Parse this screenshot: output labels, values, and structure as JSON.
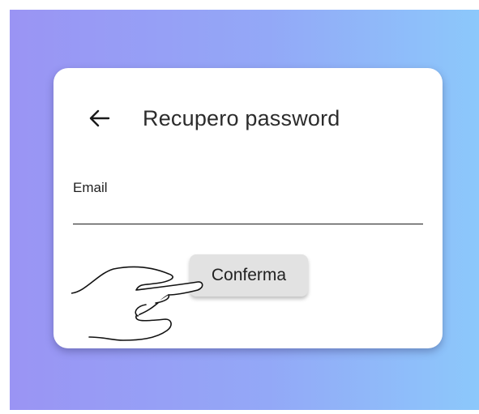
{
  "header": {
    "back_icon": "arrow-left-icon",
    "title": "Recupero password"
  },
  "form": {
    "email_label": "Email",
    "email_value": "",
    "confirm_label": "Conferma"
  },
  "decoration": {
    "pointer_icon": "pointing-hand-icon"
  },
  "colors": {
    "gradient_start": "#9a94f4",
    "gradient_end": "#8cc8fb",
    "card": "#ffffff",
    "button": "#e2e2e2"
  }
}
